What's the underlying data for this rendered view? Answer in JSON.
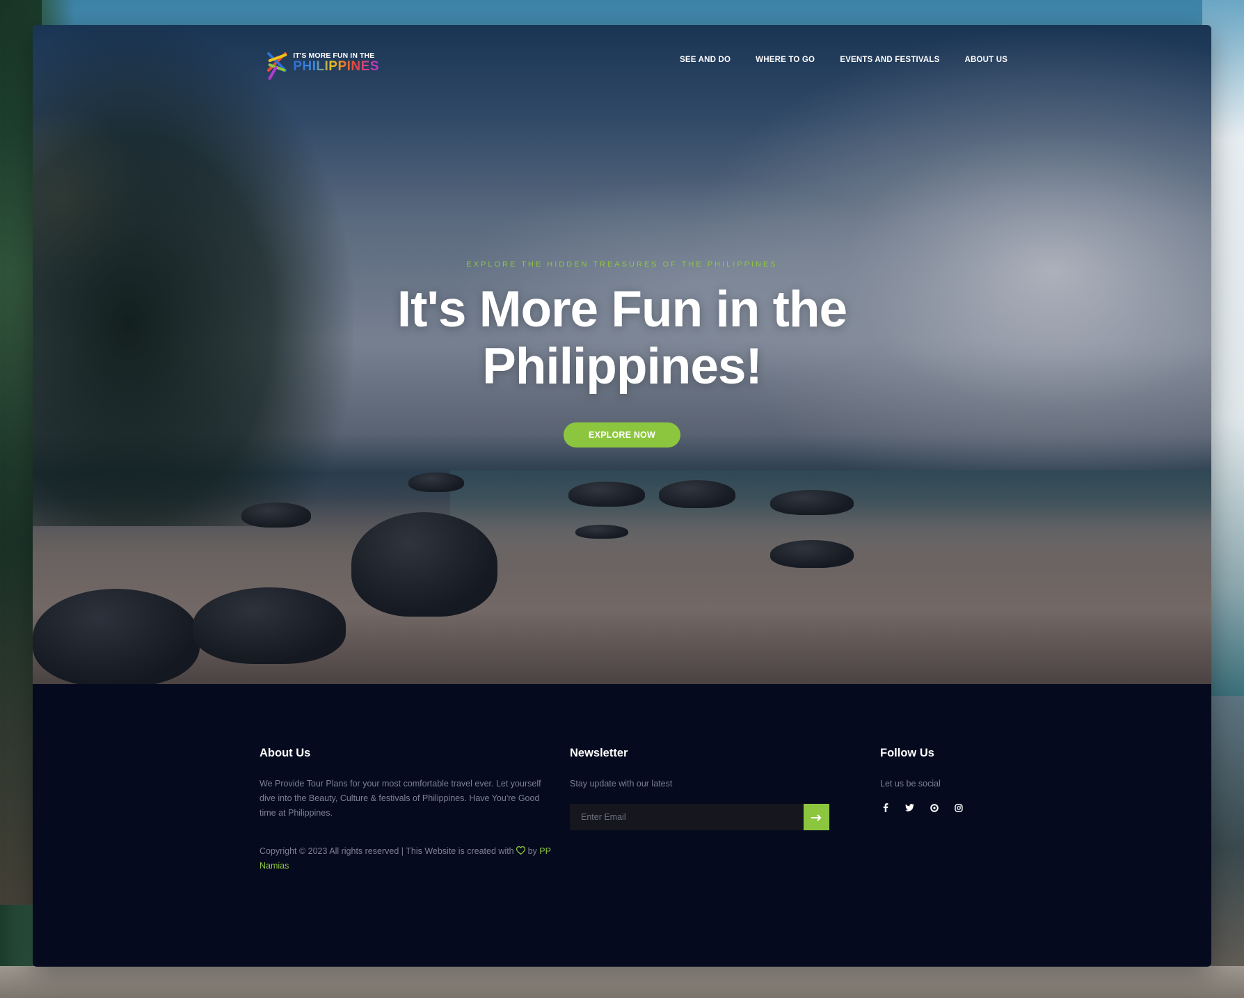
{
  "logo": {
    "line1": "IT'S MORE FUN IN THE",
    "line2": "PHILIPPINES",
    "colors": [
      "#e94a3a",
      "#2d6fd6",
      "#f0c419",
      "#8cc63f",
      "#b23bd0"
    ]
  },
  "nav": {
    "items": [
      {
        "label": "SEE AND DO"
      },
      {
        "label": "WHERE TO GO"
      },
      {
        "label": "EVENTS AND FESTIVALS"
      },
      {
        "label": "ABOUT US"
      }
    ]
  },
  "hero": {
    "eyebrow": "EXPLORE THE HIDDEN TREASURES OF THE PHILIPPINES",
    "headline_line1": "It's More Fun in the",
    "headline_line2": "Philippines!",
    "cta_label": "EXPLORE NOW"
  },
  "footer": {
    "about": {
      "title": "About Us",
      "text": "We Provide Tour Plans for your most comfortable travel ever. Let yourself dive into the Beauty, Culture & festivals of Philippines. Have You're Good time at Philippines.",
      "copyright_prefix": "Copyright © 2023 All rights reserved | This Website is created with",
      "copyright_by": "by",
      "author": "PP Namias"
    },
    "newsletter": {
      "title": "Newsletter",
      "text": "Stay update with our latest",
      "email_placeholder": "Enter Email",
      "submit_icon": "arrow-right-icon"
    },
    "follow": {
      "title": "Follow Us",
      "text": "Let us be social",
      "icons": [
        "facebook-icon",
        "twitter-icon",
        "dribbble-icon",
        "instagram-icon"
      ]
    }
  },
  "colors": {
    "accent": "#8cc63f",
    "footer_bg": "#050a1f",
    "muted_text": "#7d8191"
  }
}
